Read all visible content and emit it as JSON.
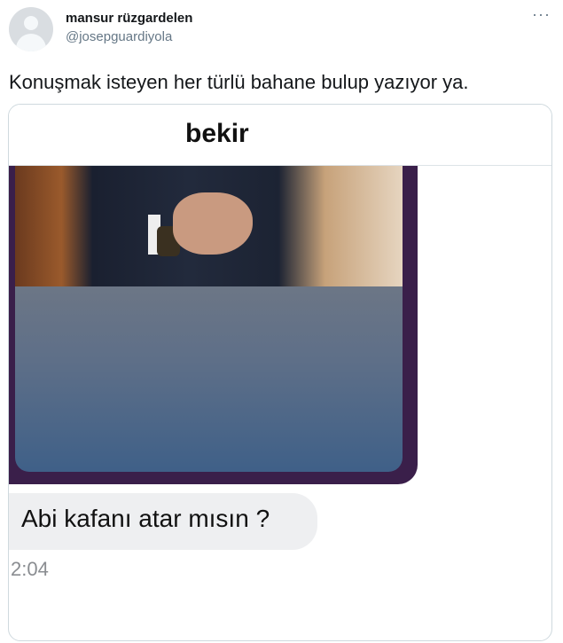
{
  "tweet": {
    "author_name": "mansur rüzgardelen",
    "author_handle": "@josepguardiyola",
    "more_icon": "more-horizontal-icon",
    "more_label": "···",
    "text": "Konuşmak isteyen her türlü bahane bulup yazıyor ya."
  },
  "chat": {
    "contact_name": "bekir",
    "message": "Abi kafanı atar mısın ?",
    "time": "2:04"
  },
  "colors": {
    "photo_bubble": "#3a1f4a",
    "message_bubble": "#eeeff1",
    "handle_gray": "#657786"
  }
}
